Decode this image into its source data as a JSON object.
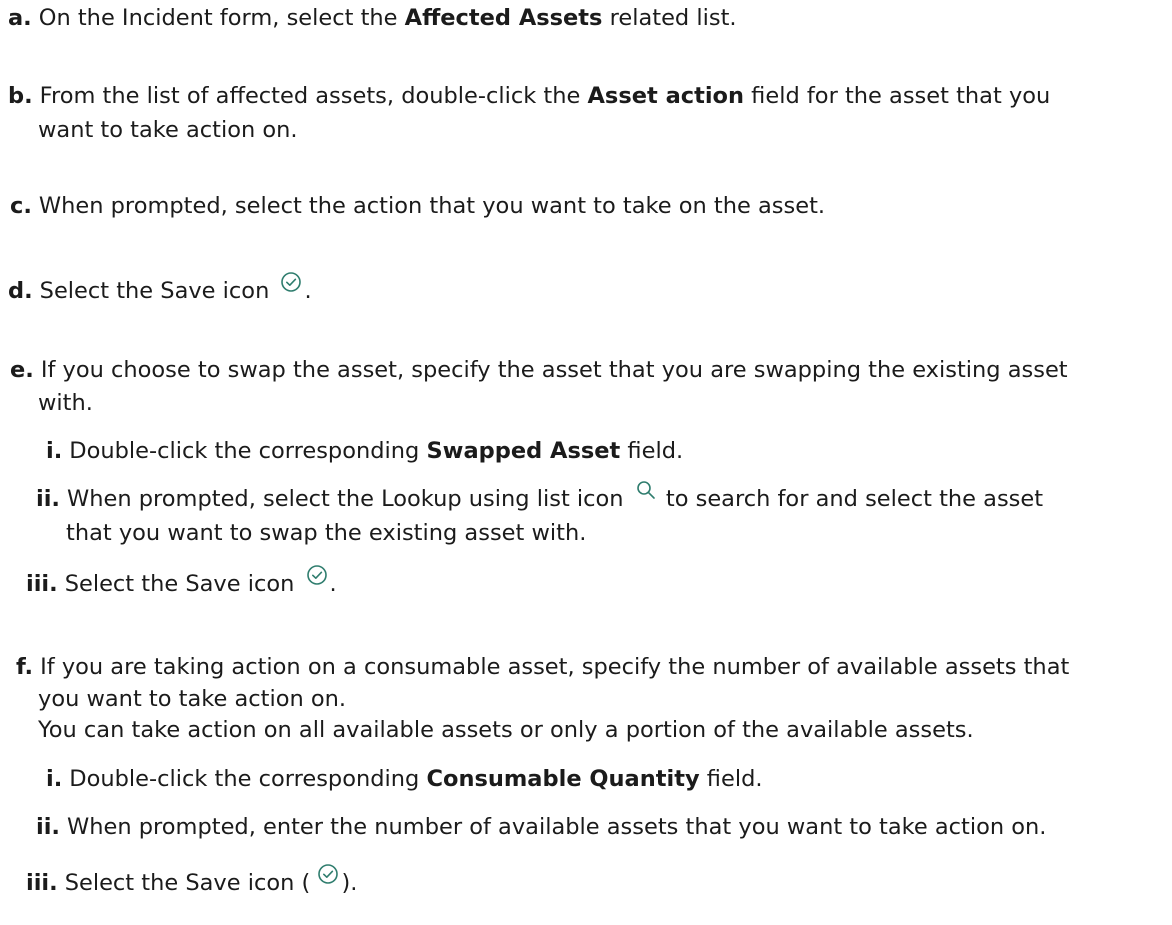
{
  "steps": {
    "a": {
      "marker": "a.",
      "text_before": "On the Incident form, select the ",
      "bold": "Affected Assets",
      "text_after": " related list."
    },
    "b": {
      "marker": "b.",
      "text_before": "From the list of affected assets, double-click the ",
      "bold": "Asset action",
      "text_after": " field for the asset that you",
      "line2": "want to take action on."
    },
    "c": {
      "marker": "c.",
      "text": "When prompted, select the action that you want to take on the asset."
    },
    "d": {
      "marker": "d.",
      "text_before": "Select the Save icon ",
      "text_after": ".",
      "icon": "save-check-icon"
    },
    "e": {
      "marker": "e.",
      "text": "If you choose to swap the asset, specify the asset that you are swapping the existing asset",
      "line2": "with.",
      "sub": {
        "i": {
          "marker": "i.",
          "text_before": "Double-click the corresponding ",
          "bold": "Swapped Asset",
          "text_after": " field."
        },
        "ii": {
          "marker": "ii.",
          "text_before": "When prompted, select the Lookup using list icon ",
          "text_after": " to search for and select the asset",
          "line2": "that you want to swap the existing asset with.",
          "icon": "search-icon"
        },
        "iii": {
          "marker": "iii.",
          "text_before": "Select the Save icon ",
          "text_after": ".",
          "icon": "save-check-icon"
        }
      }
    },
    "f": {
      "marker": "f.",
      "text": "If you are taking action on a consumable asset, specify the number of available assets that",
      "line2": "you want to take action on.",
      "line3": "You can take action on all available assets or only a portion of the available assets.",
      "sub": {
        "i": {
          "marker": "i.",
          "text_before": "Double-click the corresponding ",
          "bold": "Consumable Quantity",
          "text_after": " field."
        },
        "ii": {
          "marker": "ii.",
          "text": "When prompted, enter the number of available assets that you want to take action on."
        },
        "iii": {
          "marker": "iii.",
          "text_before": "Select the Save icon ( ",
          "text_after": ").",
          "icon": "save-check-icon"
        }
      }
    }
  },
  "colors": {
    "text": "#1b1b1b",
    "icon": "#2f7d6e"
  }
}
